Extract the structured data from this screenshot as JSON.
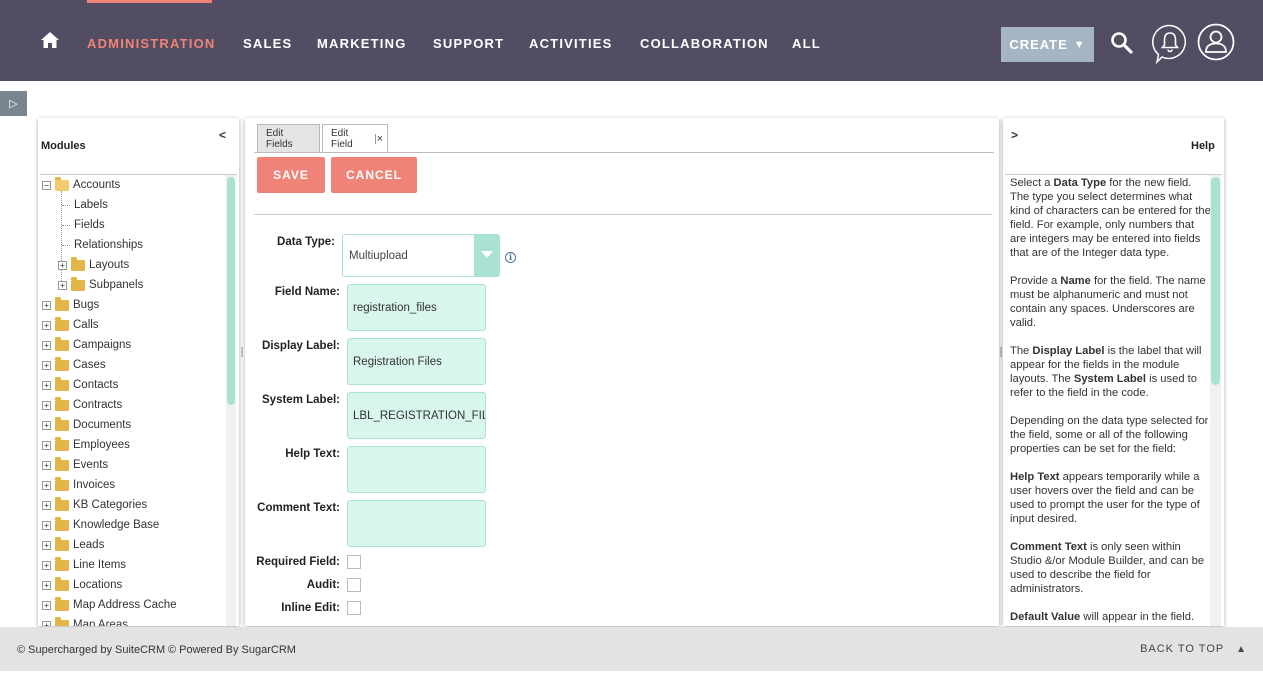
{
  "nav": {
    "items": [
      "ADMINISTRATION",
      "SALES",
      "MARKETING",
      "SUPPORT",
      "ACTIVITIES",
      "COLLABORATION",
      "ALL"
    ],
    "create_label": "CREATE",
    "create_arrow": "▼",
    "accent_color": "#f08377",
    "bar_color": "#534d64"
  },
  "left": {
    "title": "Modules",
    "collapse": "<",
    "tree": [
      {
        "label": "Accounts",
        "pm": "−",
        "level": 0,
        "open": true
      },
      {
        "label": "Labels",
        "level": 1,
        "leaf": true
      },
      {
        "label": "Fields",
        "level": 1,
        "leaf": true
      },
      {
        "label": "Relationships",
        "level": 1,
        "leaf": true
      },
      {
        "label": "Layouts",
        "pm": "+",
        "level": 1
      },
      {
        "label": "Subpanels",
        "pm": "+",
        "level": 1
      },
      {
        "label": "Bugs",
        "pm": "+",
        "level": 0
      },
      {
        "label": "Calls",
        "pm": "+",
        "level": 0
      },
      {
        "label": "Campaigns",
        "pm": "+",
        "level": 0
      },
      {
        "label": "Cases",
        "pm": "+",
        "level": 0
      },
      {
        "label": "Contacts",
        "pm": "+",
        "level": 0
      },
      {
        "label": "Contracts",
        "pm": "+",
        "level": 0
      },
      {
        "label": "Documents",
        "pm": "+",
        "level": 0
      },
      {
        "label": "Employees",
        "pm": "+",
        "level": 0
      },
      {
        "label": "Events",
        "pm": "+",
        "level": 0
      },
      {
        "label": "Invoices",
        "pm": "+",
        "level": 0
      },
      {
        "label": "KB Categories",
        "pm": "+",
        "level": 0
      },
      {
        "label": "Knowledge Base",
        "pm": "+",
        "level": 0
      },
      {
        "label": "Leads",
        "pm": "+",
        "level": 0
      },
      {
        "label": "Line Items",
        "pm": "+",
        "level": 0
      },
      {
        "label": "Locations",
        "pm": "+",
        "level": 0
      },
      {
        "label": "Map Address Cache",
        "pm": "+",
        "level": 0
      },
      {
        "label": "Map Areas",
        "pm": "+",
        "level": 0
      }
    ]
  },
  "center": {
    "tabs": [
      "Edit Fields",
      "Edit Field"
    ],
    "tab_close": "×",
    "save_label": "SAVE",
    "cancel_label": "CANCEL",
    "fields": {
      "data_type_label": "Data Type:",
      "data_type_value": "Multiupload",
      "info_glyph": "i",
      "field_name_label": "Field Name:",
      "field_name_value": "registration_files",
      "display_label_label": "Display Label:",
      "display_label_value": "Registration Files",
      "system_label_label": "System Label:",
      "system_label_value": "LBL_REGISTRATION_FILES",
      "help_text_label": "Help Text:",
      "help_text_value": "",
      "comment_text_label": "Comment Text:",
      "comment_text_value": "",
      "required_label": "Required Field:",
      "audit_label": "Audit:",
      "inline_edit_label": "Inline Edit:"
    }
  },
  "right": {
    "title": "Help",
    "expand": ">",
    "paragraphs": [
      [
        {
          "t": "Select a "
        },
        {
          "b": "Data Type"
        },
        {
          "t": " for the new field. The type you select determines what kind of characters can be entered for the field. For example, only numbers that are integers may be entered into fields that are of the Integer data type."
        }
      ],
      [
        {
          "t": "Provide a "
        },
        {
          "b": "Name"
        },
        {
          "t": " for the field. The name must be alphanumeric and must not contain any spaces. Underscores are valid."
        }
      ],
      [
        {
          "t": "The "
        },
        {
          "b": "Display Label"
        },
        {
          "t": " is the label that will appear for the fields in the module layouts. The "
        },
        {
          "b": "System Label"
        },
        {
          "t": " is used to refer to the field in the code."
        }
      ],
      [
        {
          "t": "Depending on the data type selected for the field, some or all of the following properties can be set for the field:"
        }
      ],
      [
        {
          "b": "Help Text"
        },
        {
          "t": " appears temporarily while a user hovers over the field and can be used to prompt the user for the type of input desired."
        }
      ],
      [
        {
          "b": "Comment Text"
        },
        {
          "t": " is only seen within Studio &/or Module Builder, and can be used to describe the field for administrators."
        }
      ],
      [
        {
          "b": "Default Value"
        },
        {
          "t": " will appear in the field. Users can enter a new value in the field or use the default value."
        }
      ]
    ]
  },
  "footer": {
    "left1": "© Supercharged by SuiteCRM",
    "left2": "© Powered By SugarCRM",
    "back_top": "BACK TO TOP",
    "back_top_arrow": "▲"
  }
}
